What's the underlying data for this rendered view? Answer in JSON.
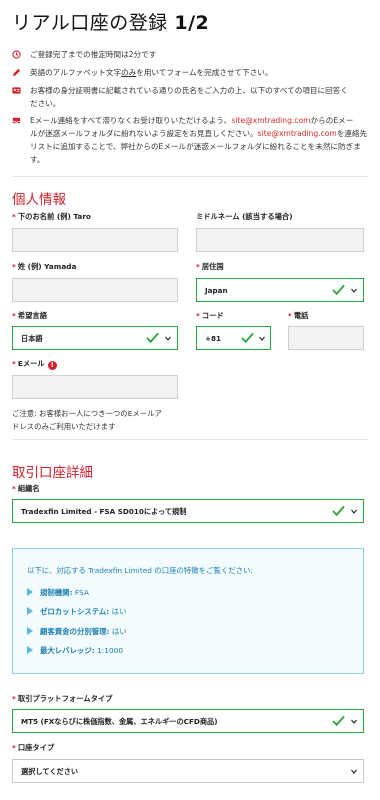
{
  "page": {
    "title": "リアル口座の登録",
    "step": "1/2"
  },
  "info": {
    "time": "ご登録完了までの推定時間は2分です",
    "alphabet_pre": "英語のアルファベット文字",
    "alphabet_em": "のみ",
    "alphabet_post": "を用いてフォームを完成させて下さい。",
    "id_line1": "お客様の身分証明書に記載されている通りの氏名をご入力の上、以下のすべての項目に回答く",
    "id_line2": "ださい。",
    "email_line1": "Eメール連絡をすべて滞りなくお受け取りいただけるよう、",
    "email_link1": "site@xmtrading.com",
    "email_line1b": "からのEメー",
    "email_line2": "ルが迷惑メールフォルダに紛れないよう設定をお見直しください。",
    "email_link2": "site@xmtrading.com",
    "email_line2b": "を連絡先",
    "email_line3": "リストに追加することで、弊社からのEメールが迷惑メールフォルダに紛れることを未然に防ぎま",
    "email_line4": "す。"
  },
  "personal": {
    "heading": "個人情報",
    "first_name_label": "下のお名前 (例) Taro",
    "middle_name_label": "ミドルネーム (該当する場合)",
    "last_name_label": "姓 (例) Yamada",
    "country_label": "居住国",
    "country_value": "Japan",
    "language_label": "希望言語",
    "language_value": "日本語",
    "code_label": "コード",
    "code_value": "+81",
    "phone_label": "電話",
    "email_label": "Eメール",
    "email_note_line1": "ご注意: お客様お一人につき一つのEメールア",
    "email_note_line2": "ドレスのみご利用いただけます"
  },
  "trading": {
    "heading": "取引口座詳細",
    "entity_label": "組織名",
    "entity_value": "Tradexfin Limited - FSA SD010によって規制",
    "infobox_intro": "以下に、対応する Tradexfin Limited の口座の特徴をご覧ください:",
    "features": [
      {
        "key": "規制機関:",
        "value": " FSA"
      },
      {
        "key": "ゼロカットシステム:",
        "value": " はい"
      },
      {
        "key": "顧客資金の分別管理:",
        "value": " はい"
      },
      {
        "key": "最大レバレッジ:",
        "value": " 1:1000"
      }
    ],
    "platform_label": "取引プラットフォームタイプ",
    "platform_value": "MT5 (FXならびに株価指数、金属、エネルギーのCFD商品)",
    "account_type_label": "口座タイプ",
    "account_type_value": "選択してください"
  },
  "colors": {
    "accent_red": "#d3202b",
    "valid_green": "#29a83d",
    "info_blue": "#1e7fb0"
  }
}
